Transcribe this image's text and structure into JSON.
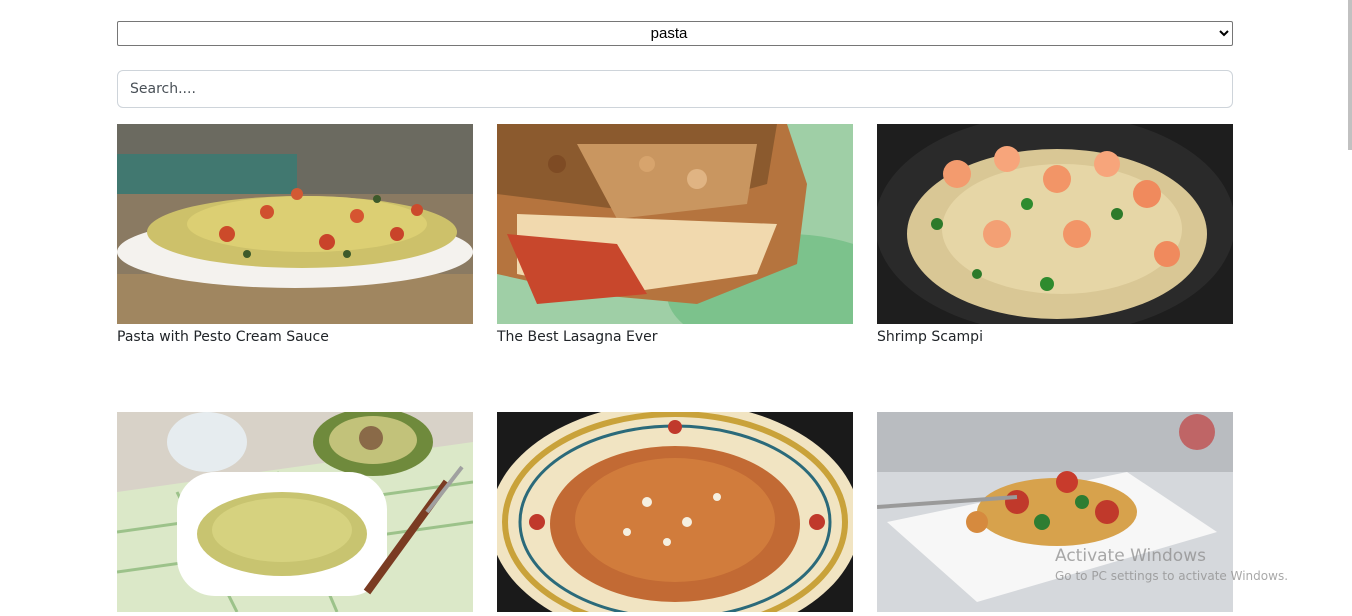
{
  "filter": {
    "selected": "pasta",
    "options": [
      "pasta"
    ]
  },
  "search": {
    "placeholder": "Search....",
    "value": ""
  },
  "recipes": [
    {
      "title": "Pasta with Pesto Cream Sauce"
    },
    {
      "title": "The Best Lasagna Ever"
    },
    {
      "title": "Shrimp Scampi"
    },
    {
      "title": ""
    },
    {
      "title": ""
    },
    {
      "title": ""
    }
  ],
  "watermark": {
    "line1": "Activate Windows",
    "line2": "Go to PC settings to activate Windows."
  }
}
